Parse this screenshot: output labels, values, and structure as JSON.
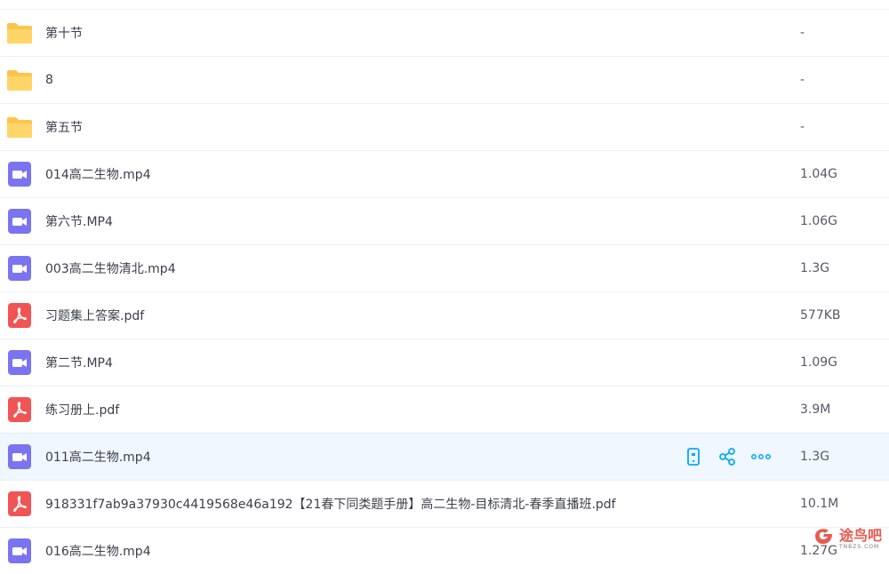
{
  "files": [
    {
      "type": "folder",
      "name": "第十节",
      "size": "-"
    },
    {
      "type": "folder",
      "name": "8",
      "size": "-"
    },
    {
      "type": "folder",
      "name": "第五节",
      "size": "-"
    },
    {
      "type": "video",
      "name": "014高二生物.mp4",
      "size": "1.04G"
    },
    {
      "type": "video",
      "name": "第六节.MP4",
      "size": "1.06G"
    },
    {
      "type": "video",
      "name": "003高二生物清北.mp4",
      "size": "1.3G"
    },
    {
      "type": "pdf",
      "name": "习题集上答案.pdf",
      "size": "577KB"
    },
    {
      "type": "video",
      "name": "第二节.MP4",
      "size": "1.09G"
    },
    {
      "type": "pdf",
      "name": "练习册上.pdf",
      "size": "3.9M"
    },
    {
      "type": "video",
      "name": "011高二生物.mp4",
      "size": "1.3G",
      "selected": true
    },
    {
      "type": "pdf",
      "name": "918331f7ab9a37930c4419568e46a192【21春下同类题手册】高二生物-目标清北-春季直播班.pdf",
      "size": "10.1M"
    },
    {
      "type": "video",
      "name": "016高二生物.mp4",
      "size": "1.27G"
    }
  ],
  "row_actions": [
    "phone-icon",
    "share-icon",
    "more-icon"
  ],
  "watermark": {
    "text": "途鸟吧",
    "sub": "TNBZS.COM"
  },
  "colors": {
    "folder": "#fcc54a",
    "video": "#7a74f0",
    "pdf": "#f05454",
    "accent": "#06a7ff"
  }
}
